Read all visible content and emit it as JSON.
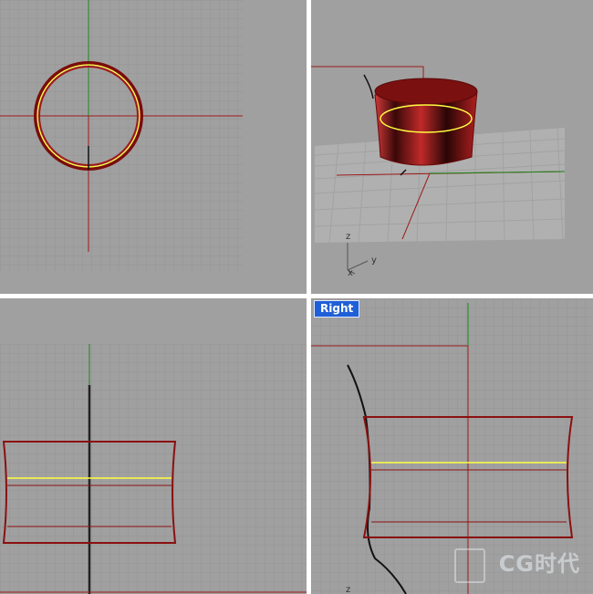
{
  "viewports": {
    "top": {
      "name": "",
      "active": false
    },
    "perspective": {
      "name": "",
      "active": false,
      "axis_y": "y",
      "axis_z": "z"
    },
    "front": {
      "name": "",
      "active": false
    },
    "right": {
      "name": "Right",
      "active": true,
      "axis_z": "z"
    }
  },
  "watermark": {
    "text": "CG时代"
  },
  "colors": {
    "viewport_bg": "#a0a0a0",
    "grid_minor": "#9a9a9a",
    "grid_major": "#8a8a8a",
    "axis_x": "#9c1a1a",
    "axis_y": "#1a8a1a",
    "curve_dark_red": "#8b1010",
    "curve_selected": "#ffff40",
    "active_label": "#1f5fd8"
  }
}
